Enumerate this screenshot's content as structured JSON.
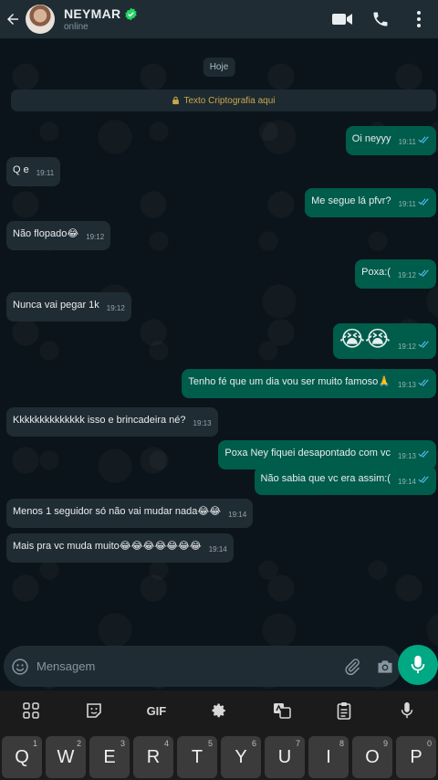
{
  "header": {
    "contact_name": "NEYMAR",
    "status": "online"
  },
  "chat": {
    "date_chip": "Hoje",
    "encryption_banner": "Texto Criptografia aqui",
    "messages": [
      {
        "dir": "out",
        "text": "Oi neyyy",
        "time": "19:11"
      },
      {
        "dir": "in",
        "text": "Q e",
        "time": "19:11"
      },
      {
        "dir": "out",
        "text": "Me segue lá pfvr?",
        "time": "19:11"
      },
      {
        "dir": "in",
        "text": "Não flopado😂",
        "time": "19:12"
      },
      {
        "dir": "out",
        "text": "Poxa:(",
        "time": "19:12"
      },
      {
        "dir": "in",
        "text": "Nunca vai pegar 1k",
        "time": "19:12"
      },
      {
        "dir": "out",
        "text": "😭😭",
        "time": "19:12"
      },
      {
        "dir": "out",
        "text": "Tenho fé que um dia vou ser muito famoso🙏",
        "time": "19:13"
      },
      {
        "dir": "in",
        "text": "Kkkkkkkkkkkkkk isso e brincadeira né?",
        "time": "19:13"
      },
      {
        "dir": "out",
        "text": "Poxa Ney fiquei desapontado com vc",
        "time": "19:13"
      },
      {
        "dir": "out",
        "text": "Não sabia que vc era assim:(",
        "time": "19:14"
      },
      {
        "dir": "in",
        "text": "Menos 1 seguidor só não vai mudar nada😂😂",
        "time": "19:14"
      },
      {
        "dir": "in",
        "text": "Mais pra vc muda muito😂😂😂😂😂😂😂",
        "time": "19:14"
      }
    ]
  },
  "composer": {
    "placeholder": "Mensagem"
  },
  "keyboard": {
    "toolbar": [
      "grid-icon",
      "sticker-icon",
      "GIF",
      "gear-icon",
      "translate-icon",
      "clipboard-icon",
      "mic-icon"
    ],
    "gif_label": "GIF",
    "top_row": [
      {
        "letter": "Q",
        "num": "1"
      },
      {
        "letter": "W",
        "num": "2"
      },
      {
        "letter": "E",
        "num": "3"
      },
      {
        "letter": "R",
        "num": "4"
      },
      {
        "letter": "T",
        "num": "5"
      },
      {
        "letter": "Y",
        "num": "6"
      },
      {
        "letter": "U",
        "num": "7"
      },
      {
        "letter": "I",
        "num": "8"
      },
      {
        "letter": "O",
        "num": "9"
      },
      {
        "letter": "P",
        "num": "0"
      }
    ]
  },
  "colors": {
    "header_bg": "#1f2c33",
    "chat_bg": "#0b141a",
    "incoming_bubble": "#202c33",
    "outgoing_bubble": "#005c4b",
    "accent": "#00a884",
    "read_ticks": "#53bdeb",
    "verified_badge": "#25d366"
  }
}
